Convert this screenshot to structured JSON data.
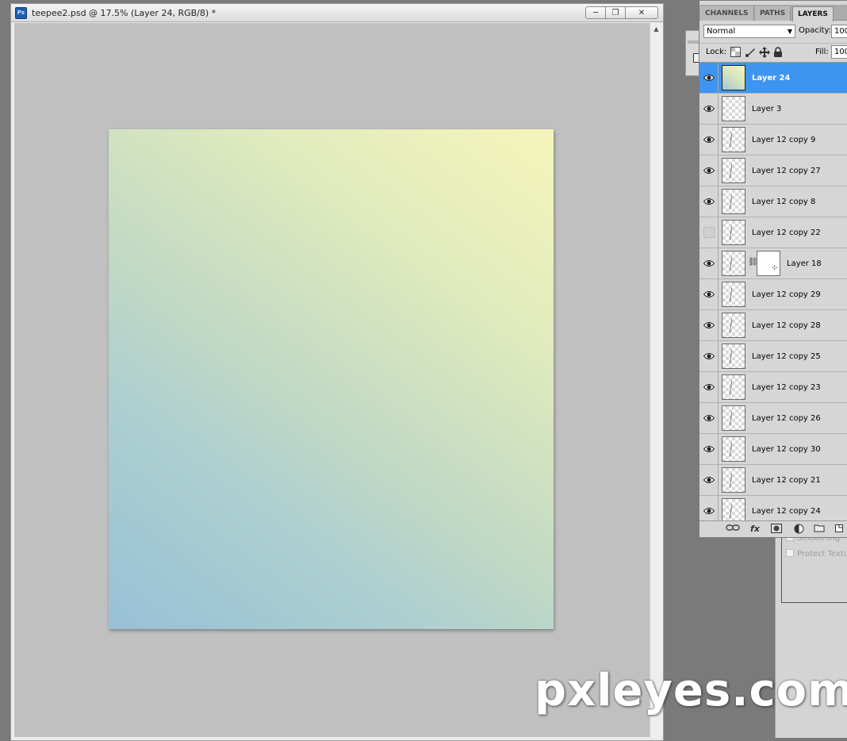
{
  "document": {
    "app_badge": "Ps",
    "title": "teepee2.psd @ 17.5% (Layer 24, RGB/8) *"
  },
  "layers_panel": {
    "tabs": [
      {
        "label": "CHANNELS",
        "active": false
      },
      {
        "label": "PATHS",
        "active": false
      },
      {
        "label": "LAYERS",
        "active": true
      }
    ],
    "blend_mode": "Normal",
    "opacity_label": "Opacity:",
    "opacity_value": "100",
    "lock_label": "Lock:",
    "fill_label": "Fill:",
    "fill_value": "100",
    "layers": [
      {
        "name": "Layer 24",
        "visible": true,
        "selected": true,
        "thumb": "gradient"
      },
      {
        "name": "Layer 3",
        "visible": true
      },
      {
        "name": "Layer 12 copy 9",
        "visible": true
      },
      {
        "name": "Layer 12 copy 27",
        "visible": true
      },
      {
        "name": "Layer 12 copy 8",
        "visible": true
      },
      {
        "name": "Layer 12 copy 22",
        "visible": false
      },
      {
        "name": "Layer 18",
        "visible": true,
        "has_mask": true
      },
      {
        "name": "Layer 12 copy 29",
        "visible": true
      },
      {
        "name": "Layer 12 copy 28",
        "visible": true
      },
      {
        "name": "Layer 12 copy 25",
        "visible": true
      },
      {
        "name": "Layer 12 copy 23",
        "visible": true
      },
      {
        "name": "Layer 12 copy 26",
        "visible": true
      },
      {
        "name": "Layer 12 copy 30",
        "visible": true
      },
      {
        "name": "Layer 12 copy 21",
        "visible": true
      },
      {
        "name": "Layer 12 copy 24",
        "visible": true
      }
    ]
  },
  "brush_options": {
    "smoothing": "Smoothing",
    "protect_texture": "Protect Texture"
  },
  "watermark": "pxleyes.com",
  "colors": {
    "selection": "#3d95f0",
    "canvas_top_right": "#f5f5b9",
    "canvas_bottom_left": "#98c0d7"
  }
}
